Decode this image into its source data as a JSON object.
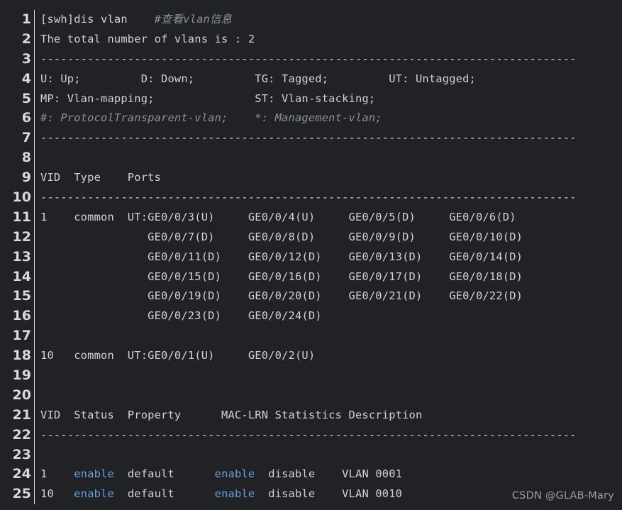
{
  "editor": {
    "background_color": "#212225",
    "text_color": "#cfd2d6",
    "gutter_color": "#d9d9d9",
    "comment_color": "#8a9199",
    "keyword_color": "#6a9ed6",
    "divider_color": "#d5d5d5",
    "first_line_number": 1,
    "last_line_number": 25,
    "total_lines": 25
  },
  "watermark": {
    "label": "CSDN @GLAB-Mary"
  },
  "lines": [
    {
      "num": "1",
      "spans": [
        {
          "style": "plain",
          "text": "[swh]dis vlan    "
        },
        {
          "style": "comment",
          "text": "#查看vlan信息"
        }
      ]
    },
    {
      "num": "2",
      "spans": [
        {
          "style": "plain",
          "text": "The total number of vlans is : 2"
        }
      ]
    },
    {
      "num": "3",
      "spans": [
        {
          "style": "dash",
          "text": "--------------------------------------------------------------------------------"
        }
      ]
    },
    {
      "num": "4",
      "spans": [
        {
          "style": "plain",
          "text": "U: Up;         D: Down;         TG: Tagged;         UT: Untagged;"
        }
      ]
    },
    {
      "num": "5",
      "spans": [
        {
          "style": "plain",
          "text": "MP: Vlan-mapping;               ST: Vlan-stacking;"
        }
      ]
    },
    {
      "num": "6",
      "spans": [
        {
          "style": "comment",
          "text": "#: ProtocolTransparent-vlan;    *: Management-vlan;"
        }
      ]
    },
    {
      "num": "7",
      "spans": [
        {
          "style": "dash",
          "text": "--------------------------------------------------------------------------------"
        }
      ]
    },
    {
      "num": "8",
      "spans": [
        {
          "style": "plain",
          "text": ""
        }
      ]
    },
    {
      "num": "9",
      "spans": [
        {
          "style": "plain",
          "text": "VID  Type    Ports"
        }
      ]
    },
    {
      "num": "10",
      "spans": [
        {
          "style": "dash",
          "text": "--------------------------------------------------------------------------------"
        }
      ]
    },
    {
      "num": "11",
      "spans": [
        {
          "style": "plain",
          "text": "1    common  UT:GE0/0/3(U)     GE0/0/4(U)     GE0/0/5(D)     GE0/0/6(D)"
        }
      ]
    },
    {
      "num": "12",
      "spans": [
        {
          "style": "plain",
          "text": "                GE0/0/7(D)     GE0/0/8(D)     GE0/0/9(D)     GE0/0/10(D)"
        }
      ]
    },
    {
      "num": "13",
      "spans": [
        {
          "style": "plain",
          "text": "                GE0/0/11(D)    GE0/0/12(D)    GE0/0/13(D)    GE0/0/14(D)"
        }
      ]
    },
    {
      "num": "14",
      "spans": [
        {
          "style": "plain",
          "text": "                GE0/0/15(D)    GE0/0/16(D)    GE0/0/17(D)    GE0/0/18(D)"
        }
      ]
    },
    {
      "num": "15",
      "spans": [
        {
          "style": "plain",
          "text": "                GE0/0/19(D)    GE0/0/20(D)    GE0/0/21(D)    GE0/0/22(D)"
        }
      ]
    },
    {
      "num": "16",
      "spans": [
        {
          "style": "plain",
          "text": "                GE0/0/23(D)    GE0/0/24(D)"
        }
      ]
    },
    {
      "num": "17",
      "spans": [
        {
          "style": "plain",
          "text": ""
        }
      ]
    },
    {
      "num": "18",
      "spans": [
        {
          "style": "plain",
          "text": "10   common  UT:GE0/0/1(U)     GE0/0/2(U)"
        }
      ]
    },
    {
      "num": "19",
      "spans": [
        {
          "style": "plain",
          "text": ""
        }
      ]
    },
    {
      "num": "20",
      "spans": [
        {
          "style": "plain",
          "text": ""
        }
      ]
    },
    {
      "num": "21",
      "spans": [
        {
          "style": "plain",
          "text": "VID  Status  Property      MAC-LRN Statistics Description"
        }
      ]
    },
    {
      "num": "22",
      "spans": [
        {
          "style": "dash",
          "text": "--------------------------------------------------------------------------------"
        }
      ]
    },
    {
      "num": "23",
      "spans": [
        {
          "style": "plain",
          "text": ""
        }
      ]
    },
    {
      "num": "24",
      "spans": [
        {
          "style": "plain",
          "text": "1    "
        },
        {
          "style": "blue",
          "text": "enable"
        },
        {
          "style": "plain",
          "text": "  default      "
        },
        {
          "style": "blue",
          "text": "enable"
        },
        {
          "style": "plain",
          "text": "  disable    VLAN 0001"
        }
      ]
    },
    {
      "num": "25",
      "spans": [
        {
          "style": "plain",
          "text": "10   "
        },
        {
          "style": "blue",
          "text": "enable"
        },
        {
          "style": "plain",
          "text": "  default      "
        },
        {
          "style": "blue",
          "text": "enable"
        },
        {
          "style": "plain",
          "text": "  disable    VLAN 0010"
        }
      ]
    }
  ],
  "vlan_summary": {
    "command": "dis vlan",
    "prompt": "[swh]",
    "total_vlans": 2,
    "legend": [
      {
        "code": "U",
        "meaning": "Up"
      },
      {
        "code": "D",
        "meaning": "Down"
      },
      {
        "code": "TG",
        "meaning": "Tagged"
      },
      {
        "code": "UT",
        "meaning": "Untagged"
      },
      {
        "code": "MP",
        "meaning": "Vlan-mapping"
      },
      {
        "code": "ST",
        "meaning": "Vlan-stacking"
      },
      {
        "code": "#",
        "meaning": "ProtocolTransparent-vlan"
      },
      {
        "code": "*",
        "meaning": "Management-vlan"
      }
    ],
    "ports_table": {
      "headers": [
        "VID",
        "Type",
        "Ports"
      ],
      "rows": [
        {
          "vid": "1",
          "type": "common",
          "ports": [
            "UT:GE0/0/3(U)",
            "GE0/0/4(U)",
            "GE0/0/5(D)",
            "GE0/0/6(D)",
            "GE0/0/7(D)",
            "GE0/0/8(D)",
            "GE0/0/9(D)",
            "GE0/0/10(D)",
            "GE0/0/11(D)",
            "GE0/0/12(D)",
            "GE0/0/13(D)",
            "GE0/0/14(D)",
            "GE0/0/15(D)",
            "GE0/0/16(D)",
            "GE0/0/17(D)",
            "GE0/0/18(D)",
            "GE0/0/19(D)",
            "GE0/0/20(D)",
            "GE0/0/21(D)",
            "GE0/0/22(D)",
            "GE0/0/23(D)",
            "GE0/0/24(D)"
          ]
        },
        {
          "vid": "10",
          "type": "common",
          "ports": [
            "UT:GE0/0/1(U)",
            "GE0/0/2(U)"
          ]
        }
      ]
    },
    "status_table": {
      "headers": [
        "VID",
        "Status",
        "Property",
        "MAC-LRN",
        "Statistics",
        "Description"
      ],
      "rows": [
        {
          "vid": "1",
          "status": "enable",
          "property": "default",
          "mac_lrn": "enable",
          "statistics": "disable",
          "description": "VLAN 0001"
        },
        {
          "vid": "10",
          "status": "enable",
          "property": "default",
          "mac_lrn": "enable",
          "statistics": "disable",
          "description": "VLAN 0010"
        }
      ]
    }
  }
}
